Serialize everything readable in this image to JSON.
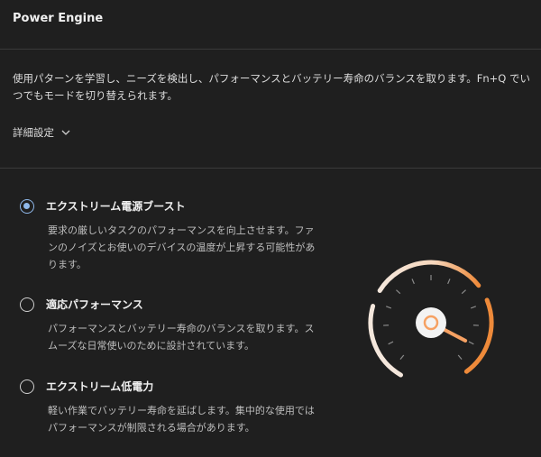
{
  "header": {
    "title": "Power Engine"
  },
  "description": "使用パターンを学習し、ニーズを検出し、パフォーマンスとバッテリー寿命のバランスを取ります。Fn+Q でいつでもモードを切り替えられます。",
  "advanced": {
    "label": "詳細設定",
    "icon": "chevron-down-icon"
  },
  "options": [
    {
      "label": "エクストリーム電源ブースト",
      "description": "要求の厳しいタスクのパフォーマンスを向上させます。ファンのノイズとお使いのデバイスの温度が上昇する可能性があります。",
      "selected": true
    },
    {
      "label": "適応パフォーマンス",
      "description": "パフォーマンスとバッテリー寿命のバランスを取ります。スムーズな日常使いのために設計されています。",
      "selected": false
    },
    {
      "label": "エクストリーム低電力",
      "description": "軽い作業でバッテリー寿命を延ばします。集中的な使用ではパフォーマンスが制限される場合があります。",
      "selected": false
    }
  ],
  "gauge": {
    "icon": "speedometer-icon",
    "level": 0.92,
    "colors": {
      "low": "#f4e7dc",
      "high": "#ee8a3a",
      "needle": "#f6a163"
    }
  }
}
